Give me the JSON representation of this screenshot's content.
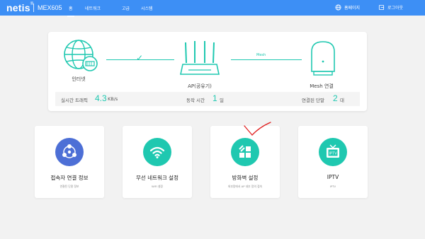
{
  "header": {
    "brand": "netis",
    "brand_mark": "®",
    "model": "MEX605",
    "nav": [
      {
        "label": "홈"
      },
      {
        "label": "네트워크"
      },
      {
        "label": "고급"
      },
      {
        "label": "시스템"
      }
    ],
    "homepage_label": "홈페이지",
    "logout_label": "로그아웃"
  },
  "status": {
    "internet_label": "인터넷",
    "ap_label": "AP(공유기)",
    "mesh_label": "Mesh 연결",
    "mesh_link_tag": "Mesh",
    "traffic_label": "실시간 트래픽",
    "traffic_value": "4.3",
    "traffic_unit": "KB/s",
    "uptime_label": "동작 시간",
    "uptime_value": "1",
    "uptime_unit": "일",
    "clients_label": "연결된 단말",
    "clients_value": "2",
    "clients_unit": "대"
  },
  "features": [
    {
      "title": "접속자 연결 정보",
      "subtitle": "연결된 단말 정보",
      "icon": "users-icon",
      "color": "#4d6fd6"
    },
    {
      "title": "무선 네트워크 설정",
      "subtitle": "WiFi 설정",
      "icon": "wifi-icon",
      "color": "#1fc8b0"
    },
    {
      "title": "방화벽 설정",
      "subtitle": "외부망에서 AP 내부 망의 접속",
      "icon": "firewall-icon",
      "color": "#1fc8b0"
    },
    {
      "title": "IPTV",
      "subtitle": "IPTV",
      "icon": "tv-icon",
      "color": "#1fc8b0"
    }
  ],
  "colors": {
    "topbar": "#3d8ff5",
    "accent": "#1fc8b0",
    "users": "#4d6fd6",
    "annotation": "#e02020"
  }
}
